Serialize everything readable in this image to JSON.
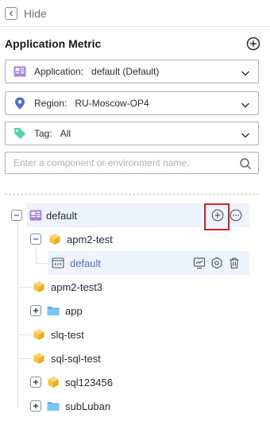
{
  "hide": {
    "label": "Hide"
  },
  "header": {
    "title": "Application Metric"
  },
  "filters": {
    "application": {
      "label": "Application:",
      "value": "default (Default)"
    },
    "region": {
      "label": "Region:",
      "value": "RU-Moscow-OP4"
    },
    "tag": {
      "label": "Tag:",
      "value": "All"
    }
  },
  "search": {
    "placeholder": "Enter a component or environment name.",
    "value": ""
  },
  "tree": {
    "root": {
      "label": "default"
    },
    "nodes": [
      {
        "label": "apm2-test",
        "type": "component",
        "expanded": true
      },
      {
        "label": "default",
        "type": "environment",
        "selected": true
      },
      {
        "label": "apm2-test3",
        "type": "component"
      },
      {
        "label": "app",
        "type": "folder",
        "expandable": true
      },
      {
        "label": "slq-test",
        "type": "component"
      },
      {
        "label": "sql-sql-test",
        "type": "component"
      },
      {
        "label": "sql123456",
        "type": "component",
        "expandable": true
      },
      {
        "label": "subLuban",
        "type": "folder",
        "expandable": true
      }
    ]
  },
  "colors": {
    "accent": "#526ecc",
    "selected_bg": "#eef3fd",
    "highlight_box": "#e02020",
    "cube": "#f6c33b",
    "folder": "#5cb6f0",
    "tag": "#50d4ab",
    "app_icon": "#a382e2"
  }
}
